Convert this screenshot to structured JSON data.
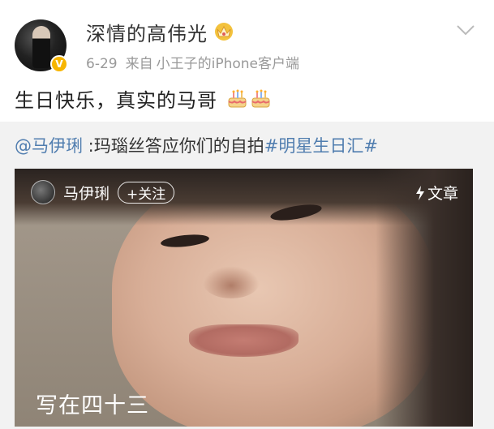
{
  "post": {
    "username": "深情的高伟光",
    "date": "6-29",
    "from_label": "来自",
    "device": "小王子的iPhone客户端",
    "text": "生日快乐，真实的马哥",
    "icons": [
      "crown-icon",
      "verified-badge-icon",
      "chevron-down-icon",
      "cake-icon",
      "cake-icon"
    ]
  },
  "repost": {
    "mention": "@马伊琍",
    "text": " :玛瑙丝答应你们的自拍",
    "hashtag": "#明星生日汇#",
    "card": {
      "author": "马伊琍",
      "follow_label": "+关注",
      "article_label": "文章",
      "caption": "写在四十三"
    }
  },
  "colors": {
    "link": "#507daf",
    "repost_bg": "#f2f2f2",
    "badge": "#f7b500"
  }
}
